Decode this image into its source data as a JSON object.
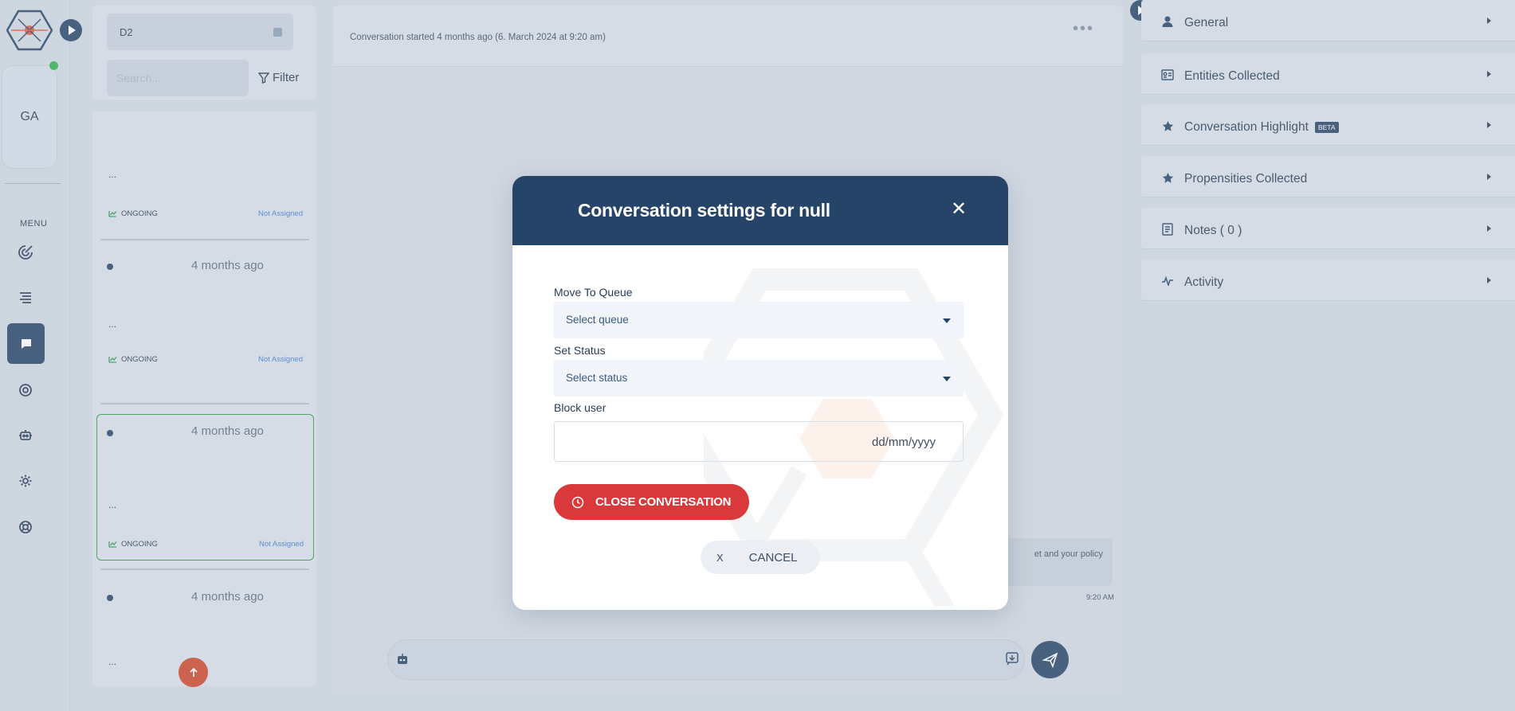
{
  "rail": {
    "avatar_initials": "GA",
    "menu_label": "MENU",
    "icons": [
      "analytics-icon",
      "list-icon",
      "chat-icon",
      "target-icon",
      "bot-icon",
      "gear-icon",
      "support-icon"
    ]
  },
  "list": {
    "queue_value": "D2",
    "search_placeholder": "Search...",
    "filter_label": "Filter",
    "items": [
      {
        "time": "",
        "preview": "...",
        "status": "ONGOING",
        "assignee": "Not Assigned"
      },
      {
        "time": "4 months ago",
        "preview": "...",
        "status": "ONGOING",
        "assignee": "Not Assigned"
      },
      {
        "time": "4 months ago",
        "preview": "...",
        "status": "ONGOING",
        "assignee": "Not Assigned"
      },
      {
        "time": "4 months ago",
        "preview": "..."
      }
    ]
  },
  "chat": {
    "started_text": "Conversation started 4 months ago (6. March 2024 at 9:20 am)",
    "more_label": "•••",
    "bubble_text": "et and your policy",
    "bubble_time": "9:20 AM"
  },
  "right_panel": {
    "sections": [
      {
        "label": "General",
        "icon": "user-icon"
      },
      {
        "label": "Entities Collected",
        "icon": "id-card-icon"
      },
      {
        "label": "Conversation Highlight",
        "icon": "star-icon",
        "badge": "BETA"
      },
      {
        "label": "Propensities Collected",
        "icon": "star-icon"
      },
      {
        "label": "Notes ( 0 )",
        "icon": "notes-icon"
      },
      {
        "label": "Activity",
        "icon": "activity-icon"
      }
    ]
  },
  "modal": {
    "title": "Conversation settings for null",
    "close_glyph": "✕",
    "queue_label": "Move To Queue",
    "queue_placeholder": "Select queue",
    "status_label": "Set Status",
    "status_placeholder": "Select status",
    "block_label": "Block user",
    "date_placeholder": "dd/mm/yyyy",
    "close_conversation_label": "CLOSE CONVERSATION",
    "cancel_x": "X",
    "cancel_label": "CANCEL"
  },
  "colors": {
    "primary": "#264467",
    "danger": "#d9393a",
    "online": "#2fb24c",
    "selected_border": "#2e9a4f",
    "assign_link": "#3f7fd1"
  }
}
